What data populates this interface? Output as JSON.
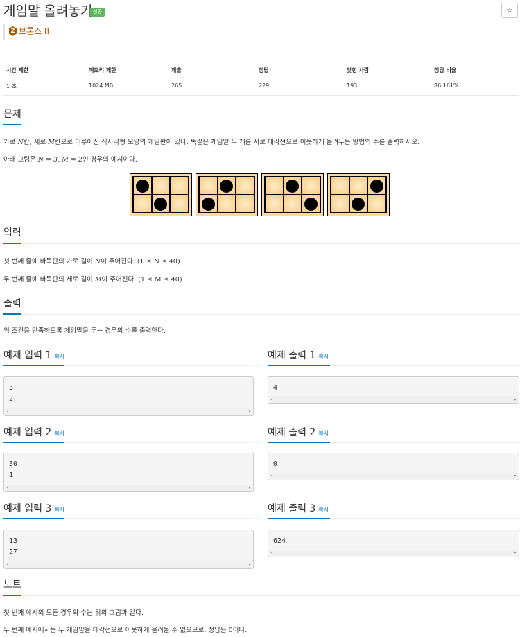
{
  "title": "게임말 올려놓기",
  "badge": "성공",
  "star_icon": "star-icon",
  "tier": {
    "number": "2",
    "label": "브론즈 II",
    "color": "#ad5600"
  },
  "stats": {
    "headers": [
      "시간 제한",
      "메모리 제한",
      "제출",
      "정답",
      "맞힌 사람",
      "정답 비율"
    ],
    "values": [
      "1 초",
      "1024 MB",
      "265",
      "229",
      "193",
      "86.161%"
    ]
  },
  "sections": {
    "problem": "문제",
    "input": "입력",
    "output": "출력",
    "note": "노트"
  },
  "problem": {
    "line1_a": "가로 ",
    "line1_N": "N",
    "line1_b": "칸, 세로 ",
    "line1_M": "M",
    "line1_c": "칸으로 이루어진 직사각형 모양의 게임판이 있다. 똑같은 게임말 두 개를 서로 대각선으로 이웃하게 올려두는 방법의 수를 출력하시오.",
    "line2_a": "아래 그림은 ",
    "line2_math": "N = 3, M = 2",
    "line2_b": "인 경우의 예시이다."
  },
  "boards": [
    {
      "stones": [
        0,
        4
      ]
    },
    {
      "stones": [
        1,
        3
      ]
    },
    {
      "stones": [
        1,
        5
      ]
    },
    {
      "stones": [
        2,
        4
      ]
    }
  ],
  "input": {
    "line1_a": "첫 번째 줄에 바둑판의 가로 길이 ",
    "line1_var": "N",
    "line1_b": "이 주어진다. ",
    "line1_math": "(1 ≤ N ≤ 40)",
    "line2_a": "두 번째 줄에 바둑판의 세로 길이 ",
    "line2_var": "M",
    "line2_b": "이 주어진다. ",
    "line2_math": "(1 ≤ M ≤ 40)"
  },
  "output": {
    "text": "위 조건을 만족하도록 게임말을 두는 경우의 수를 출력한다."
  },
  "examples": [
    {
      "in_title": "예제 입력 1",
      "out_title": "예제 출력 1",
      "copy": "복사",
      "input": "3\n2",
      "output": "4"
    },
    {
      "in_title": "예제 입력 2",
      "out_title": "예제 출력 2",
      "copy": "복사",
      "input": "30\n1",
      "output": "0"
    },
    {
      "in_title": "예제 입력 3",
      "out_title": "예제 출력 3",
      "copy": "복사",
      "input": "13\n27",
      "output": "624"
    }
  ],
  "note": {
    "line1": "첫 번째 예시의 모든 경우의 수는 위의 그림과 같다.",
    "line2_a": "두 번째 예시에서는 두 게임말을 대각선으로 이웃하게 올려둘 수 없으므로, 정답은 ",
    "line2_math": "0",
    "line2_b": "이다."
  }
}
